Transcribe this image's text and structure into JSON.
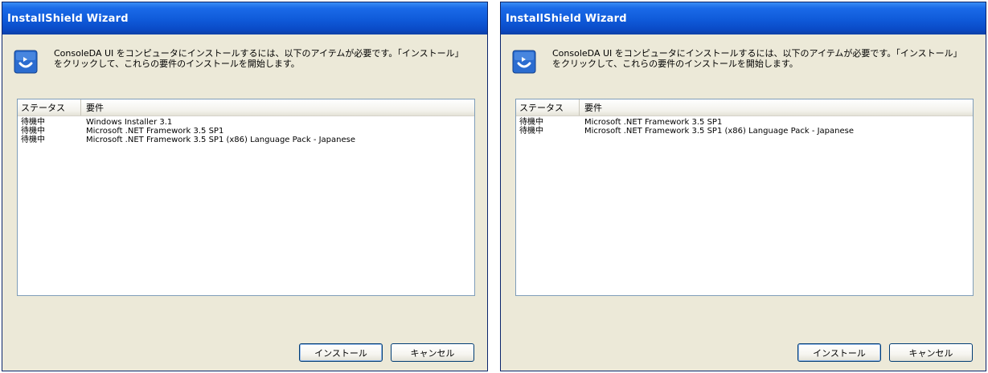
{
  "windows": [
    {
      "title": "InstallShield Wizard",
      "message": "ConsoleDA UI をコンピュータにインストールするには、以下のアイテムが必要です。「インストール」をクリックして、これらの要件のインストールを開始します。",
      "columns": {
        "status": "ステータス",
        "requirement": "要件"
      },
      "rows": [
        {
          "status": "待機中",
          "requirement": "Windows Installer 3.1"
        },
        {
          "status": "待機中",
          "requirement": "Microsoft .NET Framework 3.5 SP1"
        },
        {
          "status": "待機中",
          "requirement": "Microsoft .NET Framework 3.5 SP1 (x86) Language Pack - Japanese"
        }
      ],
      "buttons": {
        "install": "インストール",
        "cancel": "キャンセル"
      }
    },
    {
      "title": "InstallShield Wizard",
      "message": "ConsoleDA UI をコンピュータにインストールするには、以下のアイテムが必要です。「インストール」をクリックして、これらの要件のインストールを開始します。",
      "columns": {
        "status": "ステータス",
        "requirement": "要件"
      },
      "rows": [
        {
          "status": "待機中",
          "requirement": "Microsoft .NET Framework 3.5 SP1"
        },
        {
          "status": "待機中",
          "requirement": "Microsoft .NET Framework 3.5 SP1 (x86) Language Pack - Japanese"
        }
      ],
      "buttons": {
        "install": "インストール",
        "cancel": "キャンセル"
      }
    }
  ],
  "icons": {
    "app": "installer-app-icon"
  },
  "colors": {
    "titlebar": "#0f5ad9",
    "dialog_bg": "#ece9d8",
    "list_border": "#7f9db9"
  }
}
